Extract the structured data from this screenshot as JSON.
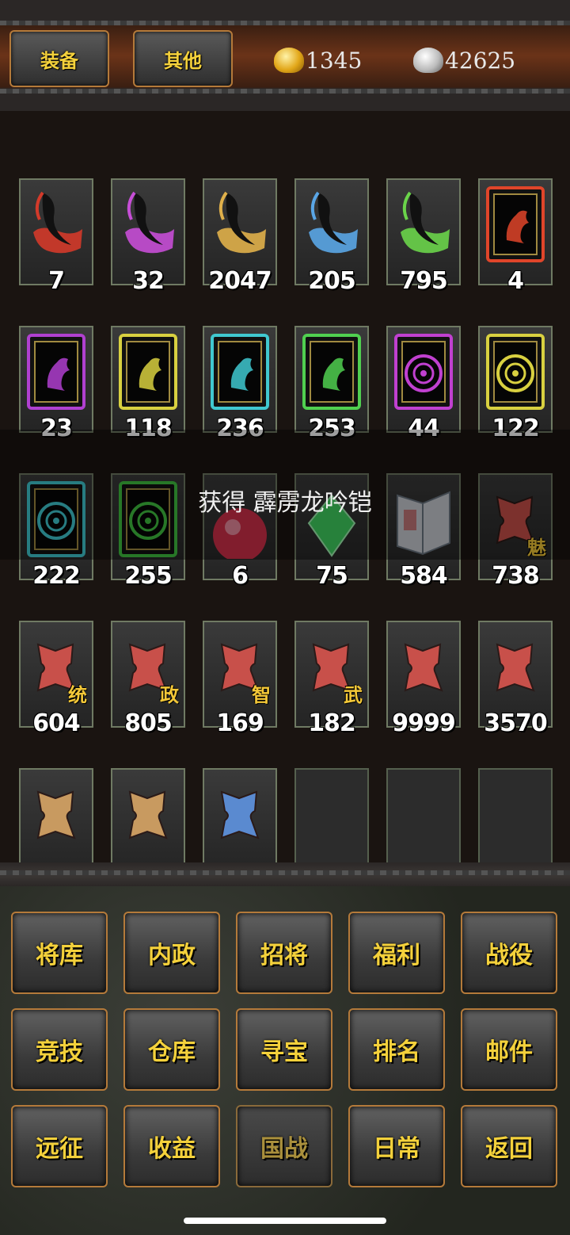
{
  "tabs": {
    "equipment": "装备",
    "other": "其他"
  },
  "currency": {
    "gold": "1345",
    "silver": "42625"
  },
  "toast": "获得 霹雳龙吟铠",
  "items": [
    {
      "icon": "scroll-blade-red-icon",
      "count": "7",
      "color": "#d33a2a"
    },
    {
      "icon": "scroll-blade-purple-icon",
      "count": "32",
      "color": "#c64ed6"
    },
    {
      "icon": "scroll-blade-gold-icon",
      "count": "2047",
      "color": "#e0b04a"
    },
    {
      "icon": "scroll-blade-blue-icon",
      "count": "205",
      "color": "#5aa6e6"
    },
    {
      "icon": "scroll-blade-green-icon",
      "count": "795",
      "color": "#6ad44a"
    },
    {
      "icon": "horse-card-red-icon",
      "count": "4",
      "color": "#e0452a"
    },
    {
      "icon": "horse-card-purple-icon",
      "count": "23",
      "color": "#b040d0"
    },
    {
      "icon": "horse-card-yellow-icon",
      "count": "118",
      "color": "#d8d040"
    },
    {
      "icon": "horse-card-cyan-icon",
      "count": "236",
      "color": "#40c8d0"
    },
    {
      "icon": "horse-card-green-icon",
      "count": "253",
      "color": "#50d050"
    },
    {
      "icon": "seal-card-purple-icon",
      "count": "44",
      "color": "#c040d0"
    },
    {
      "icon": "seal-card-yellow-icon",
      "count": "122",
      "color": "#d8d040"
    },
    {
      "icon": "seal-card-cyan-icon",
      "count": "222",
      "color": "#40c8d0"
    },
    {
      "icon": "seal-card-green-icon",
      "count": "255",
      "color": "#40c040"
    },
    {
      "icon": "red-gem-icon",
      "count": "6",
      "color": "#d0304a"
    },
    {
      "icon": "green-gem-icon",
      "count": "75",
      "color": "#40d060"
    },
    {
      "icon": "book-icon",
      "count": "584",
      "color": "#9aa6b0"
    },
    {
      "icon": "puzzle-charm-icon",
      "count": "738",
      "color": "#c8504a",
      "tag": "魅"
    },
    {
      "icon": "puzzle-command-icon",
      "count": "604",
      "color": "#c8504a",
      "tag": "统"
    },
    {
      "icon": "puzzle-politics-icon",
      "count": "805",
      "color": "#c8504a",
      "tag": "政"
    },
    {
      "icon": "puzzle-intellect-icon",
      "count": "169",
      "color": "#c8504a",
      "tag": "智"
    },
    {
      "icon": "puzzle-martial-icon",
      "count": "182",
      "color": "#c8504a",
      "tag": "武"
    },
    {
      "icon": "puzzle-red-icon",
      "count": "9999",
      "color": "#c8504a"
    },
    {
      "icon": "puzzle-red-icon",
      "count": "3570",
      "color": "#c8504a"
    },
    {
      "icon": "puzzle-tan-icon",
      "count": "",
      "color": "#c89a60"
    },
    {
      "icon": "puzzle-tan-icon",
      "count": "",
      "color": "#c89a60"
    },
    {
      "icon": "puzzle-blue-icon",
      "count": "",
      "color": "#5a8ad0"
    },
    {
      "icon": "empty-slot",
      "count": "",
      "color": ""
    },
    {
      "icon": "empty-slot",
      "count": "",
      "color": ""
    },
    {
      "icon": "empty-slot",
      "count": "",
      "color": ""
    }
  ],
  "menu": {
    "row1": [
      "将库",
      "内政",
      "招将",
      "福利",
      "战役"
    ],
    "row2": [
      "竞技",
      "仓库",
      "寻宝",
      "排名",
      "邮件"
    ],
    "row3": [
      "远征",
      "收益",
      "国战",
      "日常",
      "返回"
    ],
    "disabled": "国战"
  }
}
